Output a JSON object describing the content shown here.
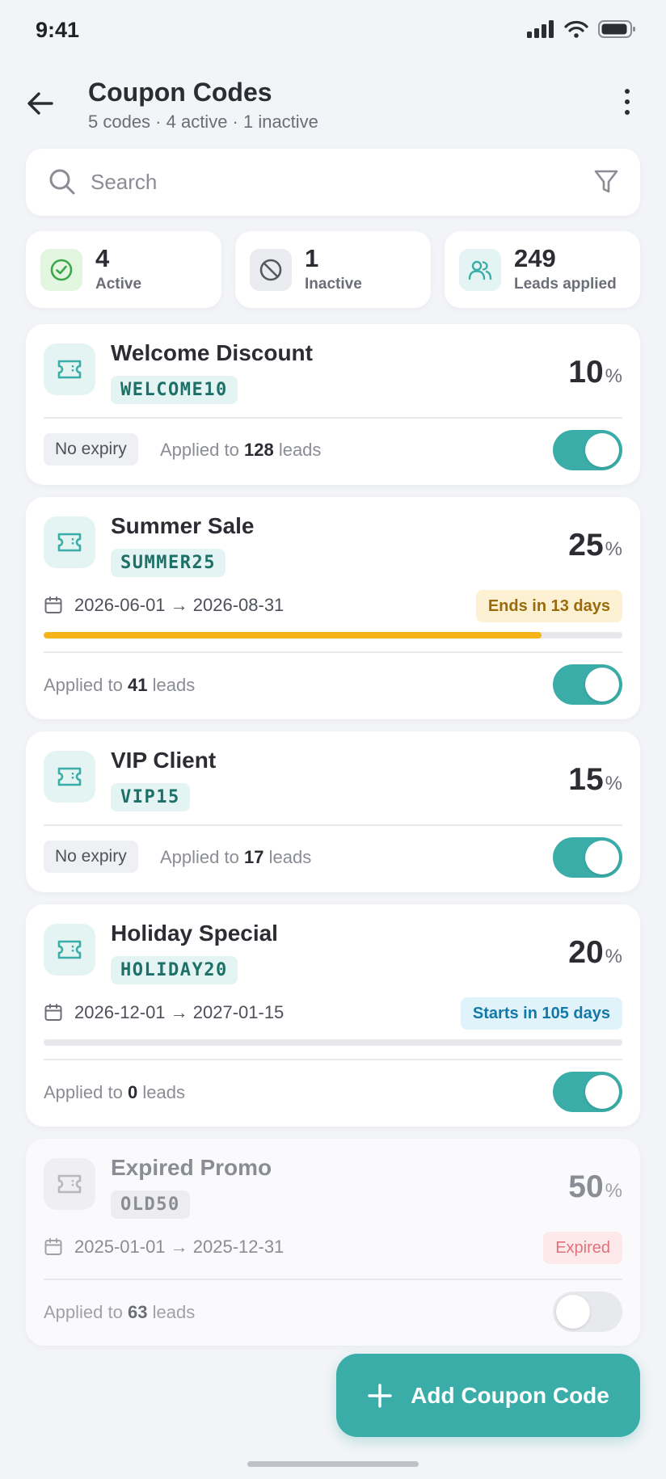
{
  "status_bar": {
    "time": "9:41"
  },
  "header": {
    "title": "Coupon Codes",
    "subtitle": "5 codes · 4 active · 1 inactive"
  },
  "search": {
    "placeholder": "Search"
  },
  "stats": [
    {
      "value": "4",
      "label": "Active",
      "icon": "check-circle-icon",
      "color": "#3aa64a"
    },
    {
      "value": "1",
      "label": "Inactive",
      "icon": "ban-icon",
      "color": "#555860"
    },
    {
      "value": "249",
      "label": "Leads applied",
      "icon": "users-icon",
      "color": "#3aada9"
    }
  ],
  "coupons": [
    {
      "name": "Welcome Discount",
      "code": "WELCOME10",
      "percent": "10",
      "percent_sign": "%",
      "expiry_label": "No expiry",
      "applied_prefix": "Applied to",
      "applied_count": "128",
      "applied_suffix": "leads",
      "enabled": true
    },
    {
      "name": "Summer Sale",
      "code": "SUMMER25",
      "percent": "25",
      "percent_sign": "%",
      "date_range": "2026-06-01 → 2026-08-31",
      "badge": "Ends in 13 days",
      "progress": 0.86,
      "applied_prefix": "Applied to",
      "applied_count": "41",
      "applied_suffix": "leads",
      "enabled": true
    },
    {
      "name": "VIP Client",
      "code": "VIP15",
      "percent": "15",
      "percent_sign": "%",
      "expiry_label": "No expiry",
      "applied_prefix": "Applied to",
      "applied_count": "17",
      "applied_suffix": "leads",
      "enabled": true
    },
    {
      "name": "Holiday Special",
      "code": "HOLIDAY20",
      "percent": "20",
      "percent_sign": "%",
      "date_range": "2026-12-01 → 2027-01-15",
      "badge": "Starts in 105 days",
      "progress": 0,
      "applied_prefix": "Applied to",
      "applied_count": "0",
      "applied_suffix": "leads",
      "enabled": true
    },
    {
      "name": "Expired Promo",
      "code": "OLD50",
      "percent": "50",
      "percent_sign": "%",
      "date_range": "2025-01-01 → 2025-12-31",
      "badge": "Expired",
      "applied_prefix": "Applied to",
      "applied_count": "63",
      "applied_suffix": "leads",
      "enabled": false
    }
  ],
  "fab": {
    "label": "Add Coupon Code",
    "icon": "plus-icon"
  },
  "colors": {
    "accent": "#3aada9",
    "warning": "#f6b41a",
    "info": "#1378a8",
    "danger": "#e0727c"
  }
}
